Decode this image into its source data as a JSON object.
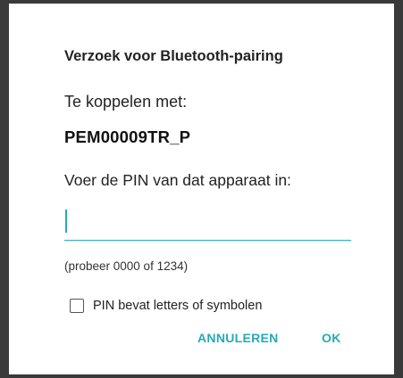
{
  "dialog": {
    "title": "Verzoek voor Bluetooth-pairing",
    "pair_label": "Te koppelen met:",
    "device_name": "PEM00009TR_P",
    "pin_prompt": "Voer de PIN van dat apparaat in:",
    "pin_value": "",
    "hint": "(probeer 0000 of 1234)",
    "checkbox_label": "PIN bevat letters of symbolen",
    "checkbox_checked": false,
    "cancel_label": "ANNULEREN",
    "ok_label": "OK"
  },
  "colors": {
    "accent": "#26aab8",
    "scrim": "#3a3a3a",
    "surface": "#ffffff"
  }
}
